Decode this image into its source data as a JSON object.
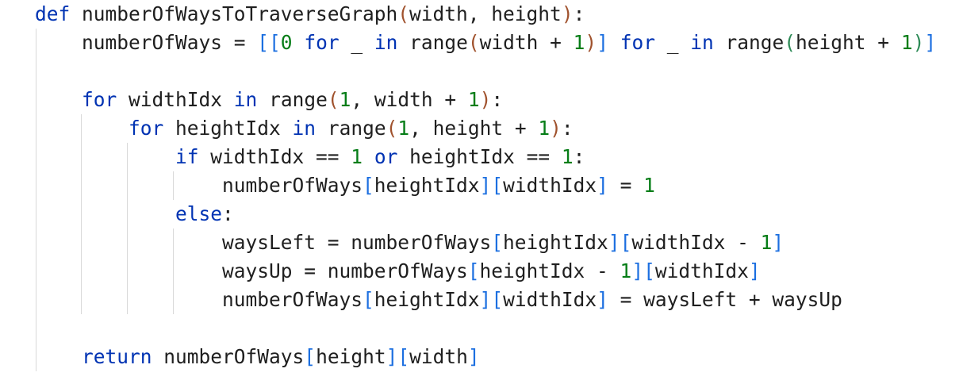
{
  "code": {
    "lines": [
      {
        "tokens": [
          {
            "t": "def",
            "c": "kw"
          },
          {
            "t": " numberOfWaysToTraverseGraph",
            "c": ""
          },
          {
            "t": "(",
            "c": "p-orange"
          },
          {
            "t": "width, height",
            "c": ""
          },
          {
            "t": ")",
            "c": "p-orange"
          },
          {
            "t": ":",
            "c": ""
          }
        ]
      },
      {
        "tokens": [
          {
            "t": "    numberOfWays = ",
            "c": ""
          },
          {
            "t": "[[",
            "c": "p-blue"
          },
          {
            "t": "0",
            "c": "num2"
          },
          {
            "t": " ",
            "c": ""
          },
          {
            "t": "for",
            "c": "kw"
          },
          {
            "t": " _ ",
            "c": ""
          },
          {
            "t": "in",
            "c": "kw"
          },
          {
            "t": " range",
            "c": ""
          },
          {
            "t": "(",
            "c": "p-orange"
          },
          {
            "t": "width + ",
            "c": ""
          },
          {
            "t": "1",
            "c": "num2"
          },
          {
            "t": ")",
            "c": "p-orange"
          },
          {
            "t": "]",
            "c": "p-blue"
          },
          {
            "t": " ",
            "c": ""
          },
          {
            "t": "for",
            "c": "kw"
          },
          {
            "t": " _ ",
            "c": ""
          },
          {
            "t": "in",
            "c": "kw"
          },
          {
            "t": " range",
            "c": ""
          },
          {
            "t": "(",
            "c": "p-green"
          },
          {
            "t": "height + ",
            "c": ""
          },
          {
            "t": "1",
            "c": "num2"
          },
          {
            "t": ")",
            "c": "p-green"
          },
          {
            "t": "]",
            "c": "p-blue"
          }
        ]
      },
      {
        "tokens": []
      },
      {
        "tokens": [
          {
            "t": "    ",
            "c": ""
          },
          {
            "t": "for",
            "c": "kw"
          },
          {
            "t": " widthIdx ",
            "c": ""
          },
          {
            "t": "in",
            "c": "kw"
          },
          {
            "t": " range",
            "c": ""
          },
          {
            "t": "(",
            "c": "p-orange"
          },
          {
            "t": "1",
            "c": "num2"
          },
          {
            "t": ", width + ",
            "c": ""
          },
          {
            "t": "1",
            "c": "num2"
          },
          {
            "t": ")",
            "c": "p-orange"
          },
          {
            "t": ":",
            "c": ""
          }
        ]
      },
      {
        "tokens": [
          {
            "t": "        ",
            "c": ""
          },
          {
            "t": "for",
            "c": "kw"
          },
          {
            "t": " heightIdx ",
            "c": ""
          },
          {
            "t": "in",
            "c": "kw"
          },
          {
            "t": " range",
            "c": ""
          },
          {
            "t": "(",
            "c": "p-orange"
          },
          {
            "t": "1",
            "c": "num2"
          },
          {
            "t": ", height + ",
            "c": ""
          },
          {
            "t": "1",
            "c": "num2"
          },
          {
            "t": ")",
            "c": "p-orange"
          },
          {
            "t": ":",
            "c": ""
          }
        ]
      },
      {
        "tokens": [
          {
            "t": "            ",
            "c": ""
          },
          {
            "t": "if",
            "c": "kw"
          },
          {
            "t": " widthIdx == ",
            "c": ""
          },
          {
            "t": "1",
            "c": "num2"
          },
          {
            "t": " ",
            "c": ""
          },
          {
            "t": "or",
            "c": "kw"
          },
          {
            "t": " heightIdx == ",
            "c": ""
          },
          {
            "t": "1",
            "c": "num2"
          },
          {
            "t": ":",
            "c": ""
          }
        ]
      },
      {
        "tokens": [
          {
            "t": "                numberOfWays",
            "c": ""
          },
          {
            "t": "[",
            "c": "p-blue"
          },
          {
            "t": "heightIdx",
            "c": ""
          },
          {
            "t": "]",
            "c": "p-blue"
          },
          {
            "t": "[",
            "c": "p-blue"
          },
          {
            "t": "widthIdx",
            "c": ""
          },
          {
            "t": "]",
            "c": "p-blue"
          },
          {
            "t": " = ",
            "c": ""
          },
          {
            "t": "1",
            "c": "num2"
          }
        ]
      },
      {
        "tokens": [
          {
            "t": "            ",
            "c": ""
          },
          {
            "t": "else",
            "c": "kw"
          },
          {
            "t": ":",
            "c": ""
          }
        ]
      },
      {
        "tokens": [
          {
            "t": "                waysLeft = numberOfWays",
            "c": ""
          },
          {
            "t": "[",
            "c": "p-blue"
          },
          {
            "t": "heightIdx",
            "c": ""
          },
          {
            "t": "]",
            "c": "p-blue"
          },
          {
            "t": "[",
            "c": "p-blue"
          },
          {
            "t": "widthIdx - ",
            "c": ""
          },
          {
            "t": "1",
            "c": "num2"
          },
          {
            "t": "]",
            "c": "p-blue"
          }
        ]
      },
      {
        "tokens": [
          {
            "t": "                waysUp = numberOfWays",
            "c": ""
          },
          {
            "t": "[",
            "c": "p-blue"
          },
          {
            "t": "heightIdx - ",
            "c": ""
          },
          {
            "t": "1",
            "c": "num2"
          },
          {
            "t": "]",
            "c": "p-blue"
          },
          {
            "t": "[",
            "c": "p-blue"
          },
          {
            "t": "widthIdx",
            "c": ""
          },
          {
            "t": "]",
            "c": "p-blue"
          }
        ]
      },
      {
        "tokens": [
          {
            "t": "                numberOfWays",
            "c": ""
          },
          {
            "t": "[",
            "c": "p-blue"
          },
          {
            "t": "heightIdx",
            "c": ""
          },
          {
            "t": "]",
            "c": "p-blue"
          },
          {
            "t": "[",
            "c": "p-blue"
          },
          {
            "t": "widthIdx",
            "c": ""
          },
          {
            "t": "]",
            "c": "p-blue"
          },
          {
            "t": " = waysLeft + waysUp",
            "c": ""
          }
        ]
      },
      {
        "tokens": []
      },
      {
        "tokens": [
          {
            "t": "    ",
            "c": ""
          },
          {
            "t": "return",
            "c": "kw"
          },
          {
            "t": " numberOfWays",
            "c": ""
          },
          {
            "t": "[",
            "c": "p-blue"
          },
          {
            "t": "height",
            "c": ""
          },
          {
            "t": "]",
            "c": "p-blue"
          },
          {
            "t": "[",
            "c": "p-blue"
          },
          {
            "t": "width",
            "c": ""
          },
          {
            "t": "]",
            "c": "p-blue"
          }
        ]
      }
    ]
  }
}
